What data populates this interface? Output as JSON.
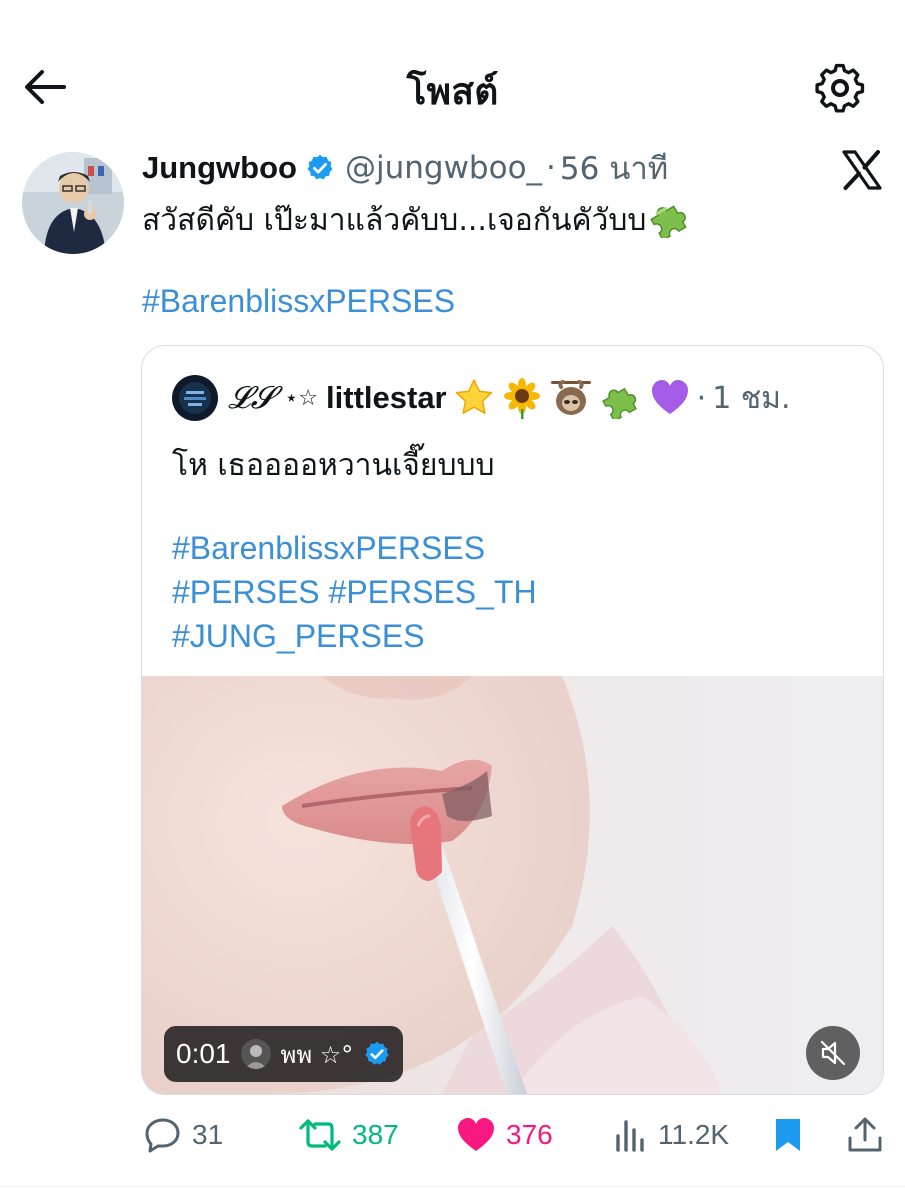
{
  "header": {
    "title": "โพสต์"
  },
  "post": {
    "author_name": "Jungwboo",
    "author_handle": "@jungwboo_",
    "separator": "·",
    "time": "56 นาที",
    "text": "สวัสดีคับ เป๊ะมาแล้วคับบ...เจอกันคัวับบ",
    "hashtag": "#BarenblissxPERSES"
  },
  "quote": {
    "name_prefix": "𝓛𝓢",
    "name_stars": "⋆☆",
    "name": "littlestar",
    "separator": "·",
    "time": "1 ชม.",
    "text": "โห เธออออหวานเจี๊ยบบบ",
    "hashtags": [
      "#BarenblissxPERSES",
      "#PERSES #PERSES_TH",
      "#JUNG_PERSES"
    ],
    "video": {
      "timestamp": "0:01",
      "uploader": "พพ ☆°"
    }
  },
  "actions": {
    "replies": "31",
    "reposts": "387",
    "likes": "376",
    "views": "11.2K"
  },
  "colors": {
    "link": "#3a8fd6",
    "verified": "#1d9bf0",
    "repost": "#00ba7c",
    "like": "#f91880",
    "muted": "#536471"
  },
  "icons": [
    "back-arrow-icon",
    "settings-gear-icon",
    "verified-badge-icon",
    "x-logo-icon",
    "puzzle-piece-icon",
    "star-icon",
    "sunflower-icon",
    "sloth-icon",
    "purple-heart-icon",
    "mute-icon",
    "reply-icon",
    "repost-icon",
    "like-icon",
    "views-icon",
    "bookmark-icon",
    "share-icon"
  ]
}
